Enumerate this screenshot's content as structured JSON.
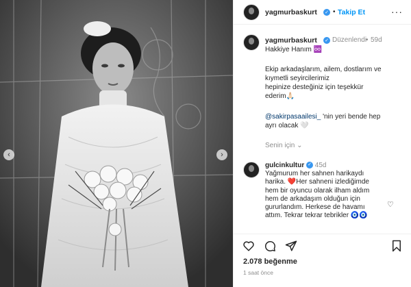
{
  "header": {
    "username": "yagmurbaskurt",
    "separator": "•",
    "follow_label": "Takip Et",
    "more_label": "···"
  },
  "caption": {
    "username": "yagmurbaskurt",
    "edited": "Düzenlendi",
    "separator": "•",
    "age": "59d",
    "line1": "Hakkiye Hanım ♾️",
    "line2": "Ekip arkadaşlarım, ailem, dostlarım ve",
    "line3": "kıymetli seyircilerimiz",
    "line4": "hepinize desteğiniz için teşekkür",
    "line5": "ederim🙏🏻",
    "mention": "@sakirpasaailesi_",
    "line6_rest": " 'nin yeri bende hep",
    "line7": "ayrı olacak 🤍",
    "translate_label": "Senin için ⌄"
  },
  "comment": {
    "username": "gulcinkultur",
    "age": "45d",
    "line1": "Yağmurum her sahnen harikaydı",
    "line2": "harika. ❤️Her sahneni izlediğimde",
    "line3": "hem bir oyuncu olarak ilham aldım",
    "line4": "hem de arkadaşım olduğun için",
    "line5": "gururlandım. Herkese de havamı",
    "line6": "attım. Tekrar tekrar tebrikler 🧿🧿"
  },
  "footer": {
    "likes": "2.078 beğenme",
    "time": "1 saat önce"
  },
  "icons": {
    "heart": "heart-icon",
    "comment": "comment-icon",
    "share": "share-icon",
    "save": "bookmark-icon",
    "prev": "chevron-left-icon",
    "next": "chevron-right-icon"
  },
  "colors": {
    "accent": "#0095f6",
    "verified": "#3897f0",
    "mention": "#00376b",
    "muted": "#8e8e8e"
  }
}
